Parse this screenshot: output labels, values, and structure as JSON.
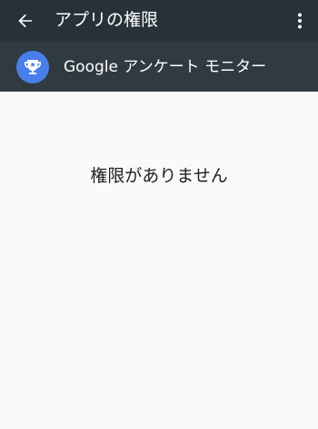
{
  "toolbar": {
    "title": "アプリの権限",
    "back_icon": "arrow-back-icon",
    "overflow_icon": "more-vert-icon",
    "background": "#263238"
  },
  "app": {
    "name": "Google アンケート モニター",
    "icon": "trophy-icon",
    "icon_color": "#4a7ee8"
  },
  "content": {
    "empty_message": "権限がありません"
  }
}
